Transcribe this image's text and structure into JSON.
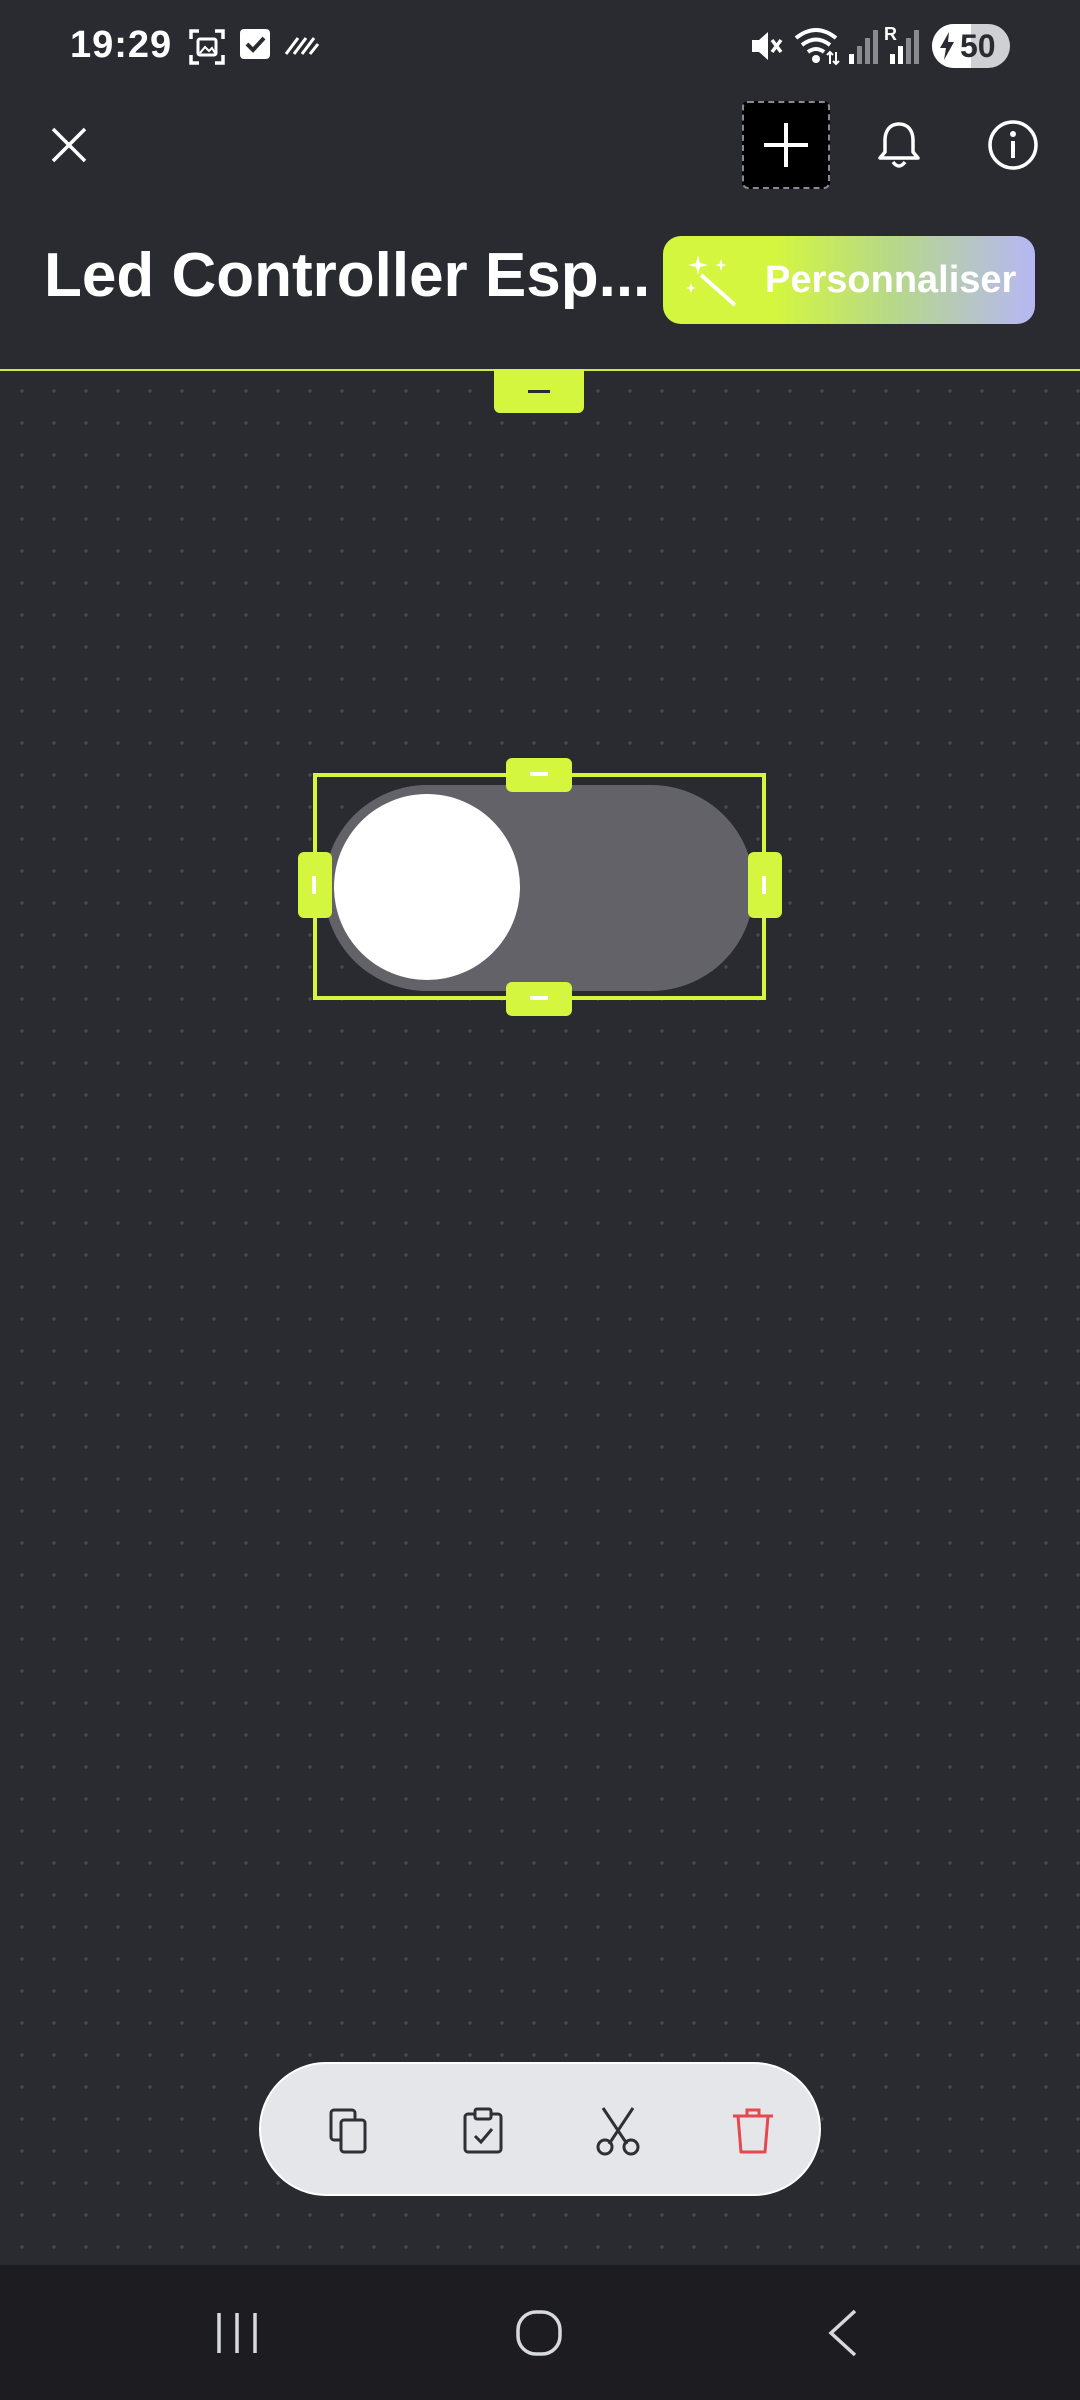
{
  "status_bar": {
    "time": "19:29",
    "battery_level": "50",
    "icons": [
      "screenshot-icon",
      "checkbox-icon",
      "data-saver-icon",
      "mute-icon",
      "wifi-icon",
      "signal-icon",
      "roaming-signal-icon",
      "charging-icon"
    ]
  },
  "toolbar": {
    "close_icon": "close-icon",
    "add_icon": "plus-icon",
    "notifications_icon": "bell-icon",
    "info_icon": "info-icon"
  },
  "header": {
    "title": "Led Controller Esp...",
    "customize_label": "Personnaliser",
    "customize_icon": "magic-wand-icon"
  },
  "canvas": {
    "widget": {
      "type": "switch",
      "state": "off"
    }
  },
  "context_bar": {
    "actions": [
      "copy-icon",
      "paste-icon",
      "cut-icon",
      "delete-icon"
    ]
  },
  "nav_bar": {
    "buttons": [
      "recent-apps-icon",
      "home-icon",
      "back-icon"
    ]
  },
  "colors": {
    "background": "#2a2b30",
    "accent": "#d4f63f",
    "gradient_end": "#b6b7f4",
    "switch_track": "#626268",
    "context_bar": "#e5e6ea",
    "delete": "#e5484d",
    "nav_bar": "#1c1c21"
  }
}
